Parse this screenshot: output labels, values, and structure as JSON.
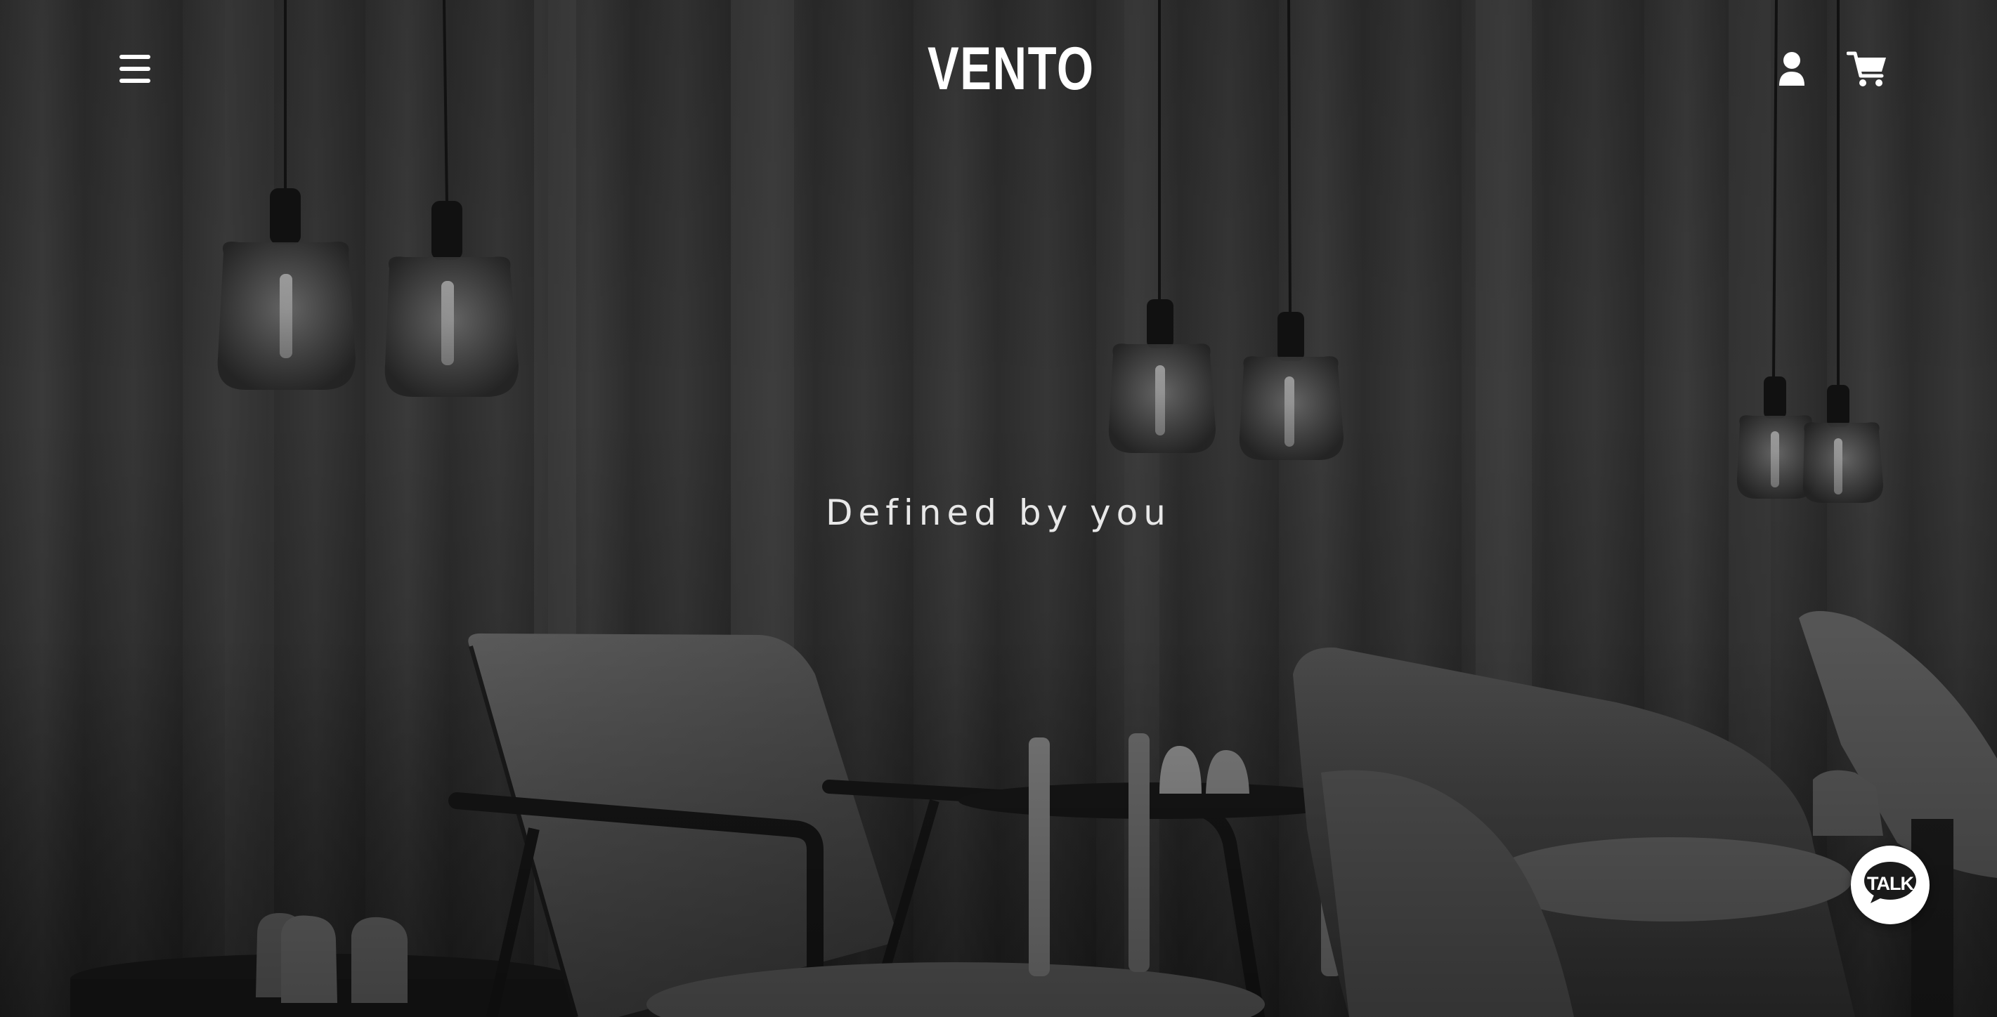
{
  "brand": {
    "logo_text": "VENTO"
  },
  "header": {
    "menu_icon": "hamburger-menu-icon",
    "account_icon": "user-icon",
    "cart_icon": "shopping-cart-icon"
  },
  "hero": {
    "tagline": "Defined by you",
    "background_description_colors": {
      "base": "#2e2e2e",
      "text": "#e8e8e8"
    }
  },
  "chat": {
    "label": "TALK",
    "icon": "chat-bubble-icon"
  }
}
